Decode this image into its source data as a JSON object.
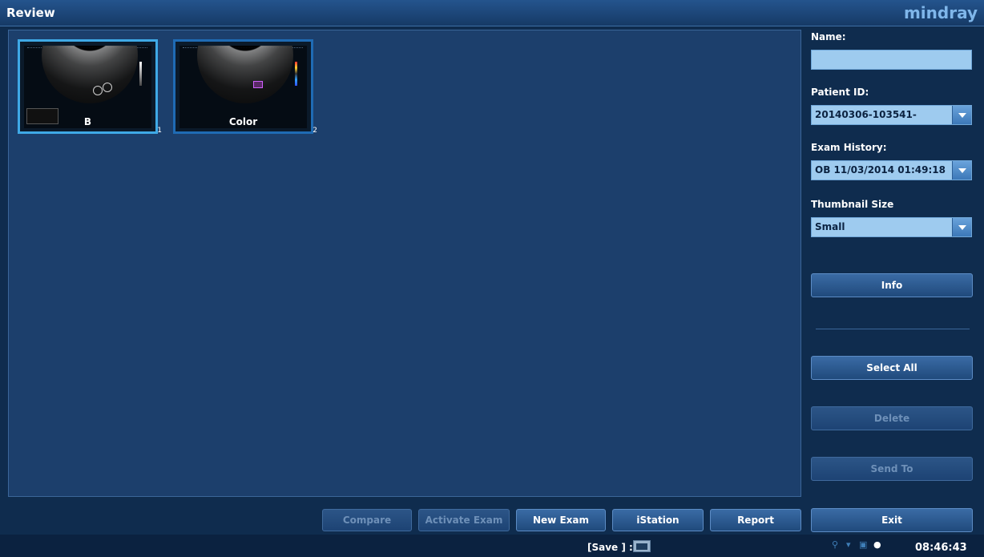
{
  "app": {
    "title": "Review",
    "brand": "mindray"
  },
  "thumbnails": [
    {
      "label": "B",
      "index": "1",
      "selected": true
    },
    {
      "label": "Color",
      "index": "2",
      "selected": false
    }
  ],
  "sidebar": {
    "name_label": "Name:",
    "name_value": "",
    "patient_id_label": "Patient ID:",
    "patient_id_value": "20140306-103541-",
    "exam_history_label": "Exam History:",
    "exam_history_value": "OB 11/03/2014 01:49:18",
    "thumbnail_size_label": "Thumbnail Size",
    "thumbnail_size_value": "Small",
    "info_button": "Info",
    "select_all_button": "Select All",
    "delete_button": "Delete",
    "send_to_button": "Send To",
    "exit_button": "Exit"
  },
  "toolbar": {
    "compare": "Compare",
    "activate_exam": "Activate Exam",
    "new_exam": "New Exam",
    "istation": "iStation",
    "report": "Report"
  },
  "status": {
    "save_label": "[Save ] :",
    "time": "08:46:43"
  },
  "icons": [
    "save-icon",
    "network-icon",
    "usb-icon",
    "printer-icon",
    "disk-icon"
  ],
  "colors": {
    "background": "#0f2c4e",
    "panel": "#1c3f6c",
    "field": "#9ecbef",
    "brand": "#7fb6ea"
  }
}
